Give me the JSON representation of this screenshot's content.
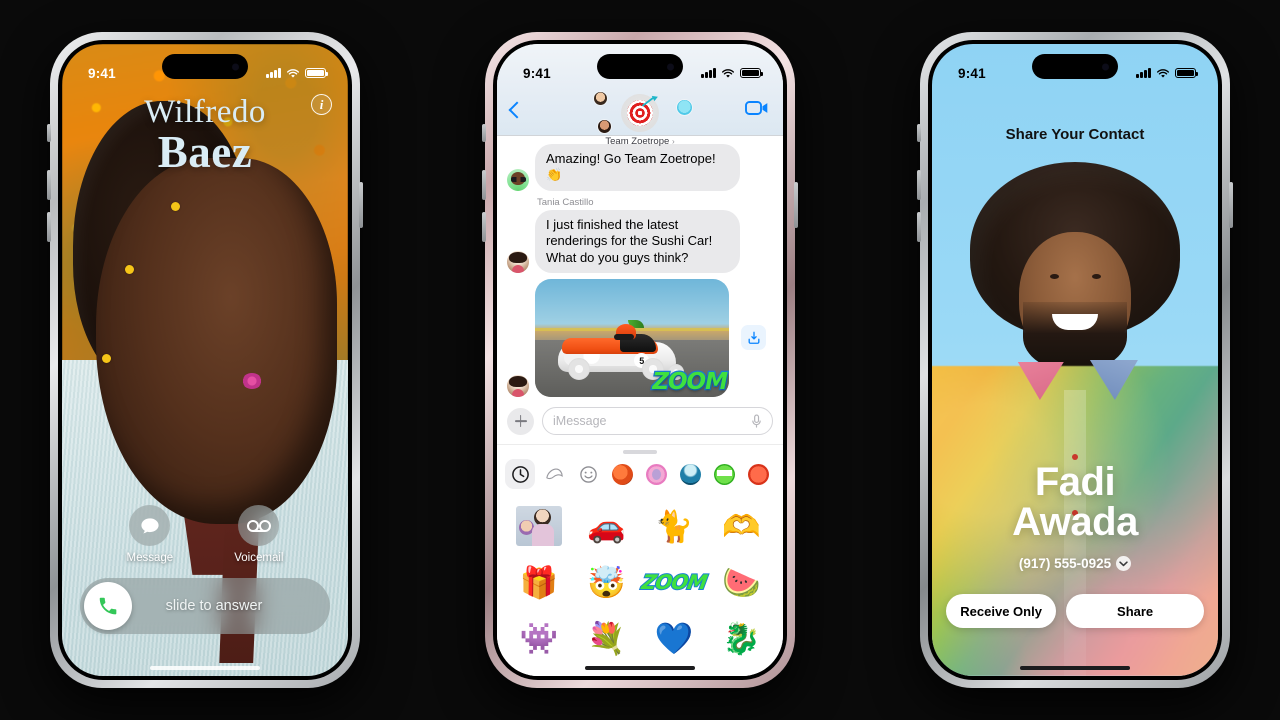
{
  "scene": {
    "background_color": "#0a0a0a",
    "device_count": 3
  },
  "phone_call": {
    "frame_finish": "silver-titanium",
    "status_bar": {
      "time": "9:41",
      "signal": "cellular-bars",
      "wifi": "wifi-icon",
      "battery": "battery-full"
    },
    "caller": {
      "first_name": "Wilfredo",
      "last_name": "Baez"
    },
    "info_button": "i",
    "actions": [
      {
        "id": "message",
        "label": "Message",
        "icon": "message-bubble-icon"
      },
      {
        "id": "voicemail",
        "label": "Voicemail",
        "icon": "voicemail-icon"
      }
    ],
    "slider": {
      "label": "slide to answer",
      "icon": "phone-handset-icon",
      "icon_color": "#34c759"
    }
  },
  "phone_messages": {
    "frame_finish": "rose-titanium",
    "status_bar": {
      "time": "9:41",
      "signal": "cellular-bars",
      "wifi": "wifi-icon",
      "battery": "battery-full"
    },
    "header": {
      "back_label": "back-chevron",
      "group_name": "Team Zoetrope",
      "group_chevron": "›",
      "group_avatar_icon": "dartboard-target-icon",
      "facetime_label": "video-camera-icon"
    },
    "messages": [
      {
        "id": "m1",
        "sender": "",
        "text": "Amazing! Go Team Zoetrope! 👏",
        "avatar": "memoji-avatar"
      },
      {
        "id": "m2",
        "sender": "Tania Castillo",
        "text": "I just finished the latest renderings for the Sushi Car! What do you guys think?",
        "avatar": "photo-avatar"
      }
    ],
    "attachment": {
      "type": "image",
      "description": "sushi-race-car",
      "car_number": "5",
      "sticker_text": "ZOOM",
      "save_icon": "save-to-photos-icon"
    },
    "composer": {
      "add_label": "plus-icon",
      "placeholder": "iMessage",
      "mic_label": "microphone-icon"
    },
    "sticker_drawer": {
      "tabs": [
        {
          "id": "recents",
          "icon": "clock-icon",
          "selected": true
        },
        {
          "id": "fortune-cookie",
          "icon": "fortune-cookie-icon",
          "selected": false
        },
        {
          "id": "emoji",
          "icon": "smiley-face-icon",
          "selected": false
        },
        {
          "id": "sushi-pack",
          "icon": "sushi-pack-icon",
          "selected": false
        },
        {
          "id": "pink-pack",
          "icon": "pink-pack-icon",
          "selected": false
        },
        {
          "id": "teal-pack",
          "icon": "teal-pack-icon",
          "selected": false
        },
        {
          "id": "frog-pack",
          "icon": "frog-pack-icon",
          "selected": false
        },
        {
          "id": "red-pack",
          "icon": "red-pack-icon",
          "selected": false
        }
      ],
      "stickers": [
        {
          "id": "s1",
          "label": "family-photo-sticker",
          "glyph": ""
        },
        {
          "id": "s2",
          "label": "red-car-sticker",
          "glyph": "🚗"
        },
        {
          "id": "s3",
          "label": "dancing-cat-sticker",
          "glyph": "🐈"
        },
        {
          "id": "s4",
          "label": "heart-hands-sticker",
          "glyph": "🫶"
        },
        {
          "id": "s5",
          "label": "gift-box-sticker",
          "glyph": "🎁"
        },
        {
          "id": "s6",
          "label": "mind-blown-memoji",
          "glyph": "🤯"
        },
        {
          "id": "s7",
          "label": "zoom-text-sticker",
          "glyph": "ZOOM"
        },
        {
          "id": "s8",
          "label": "watermelon-sticker",
          "glyph": "🍉"
        },
        {
          "id": "s9",
          "label": "purple-monster-sticker",
          "glyph": "👾"
        },
        {
          "id": "s10",
          "label": "flower-bouquet-sticker",
          "glyph": "💐"
        },
        {
          "id": "s11",
          "label": "blue-heart-sticker",
          "glyph": "💙"
        },
        {
          "id": "s12",
          "label": "fire-dragon-sticker",
          "glyph": "🐉"
        }
      ]
    }
  },
  "phone_namedrop": {
    "frame_finish": "graphite-titanium",
    "status_bar": {
      "time": "9:41",
      "signal": "cellular-bars",
      "wifi": "wifi-icon",
      "battery": "battery-full"
    },
    "title": "Share Your Contact",
    "contact": {
      "first_name": "Fadi",
      "last_name": "Awada",
      "phone": "(917) 555-0925",
      "phone_chevron": "chevron-down-icon"
    },
    "buttons": [
      {
        "id": "receive-only",
        "label": "Receive Only"
      },
      {
        "id": "share",
        "label": "Share"
      }
    ]
  }
}
